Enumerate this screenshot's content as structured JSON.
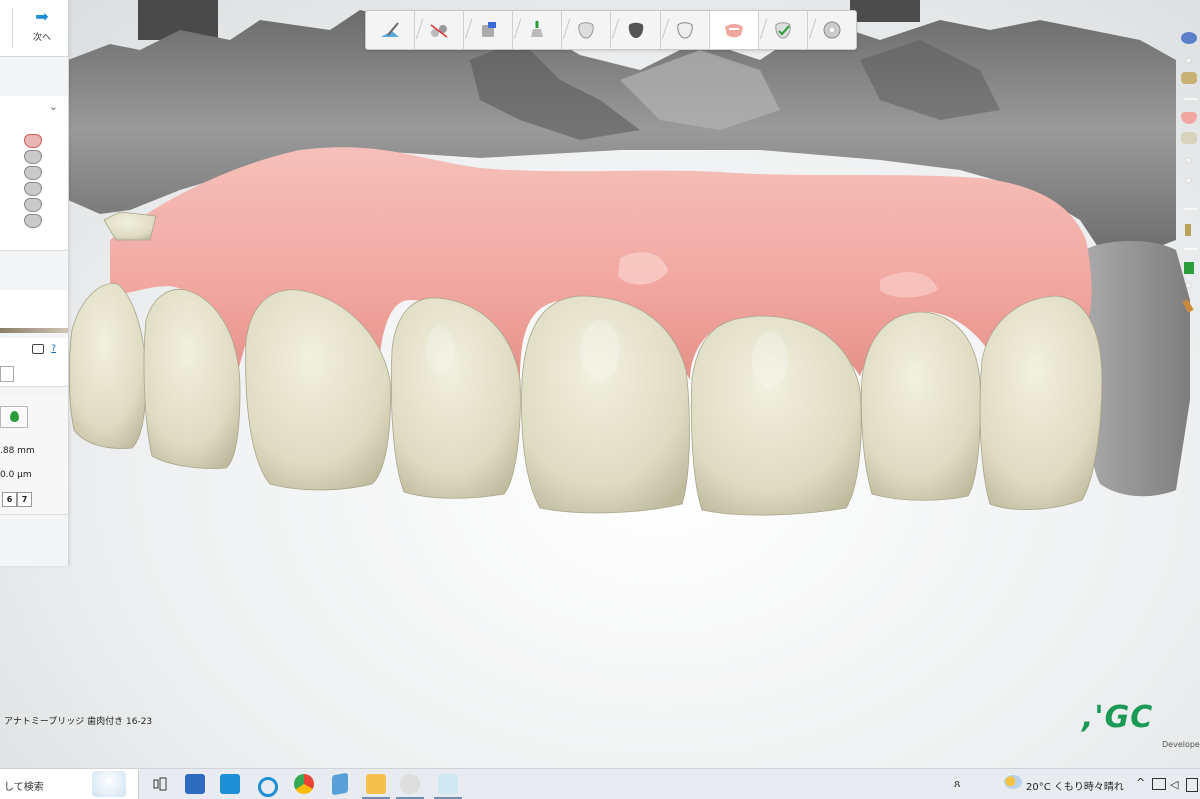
{
  "left_panel": {
    "next_label": "次へ",
    "help_link": "?",
    "thickness_value": ".88 mm",
    "offset_value": "0.0 μm",
    "number_boxes": [
      "6",
      "7"
    ]
  },
  "toolbar": {
    "steps": [
      {
        "icon": "scan-tool-icon"
      },
      {
        "icon": "trim-tool-icon"
      },
      {
        "icon": "die-tool-icon"
      },
      {
        "icon": "margin-tool-icon"
      },
      {
        "icon": "tooth-shape-icon"
      },
      {
        "icon": "tooth-dark-icon"
      },
      {
        "icon": "tooth-outline-icon"
      },
      {
        "icon": "gingiva-icon"
      },
      {
        "icon": "tooth-check-icon"
      },
      {
        "icon": "disc-export-icon"
      }
    ],
    "active_step": 7
  },
  "case_label": "アナトミーブリッジ 歯肉付き 16-23",
  "brand": {
    "logo_text": ",'GC",
    "subtitle": "Developed",
    "color": "#1a9a55"
  },
  "taskbar": {
    "search_text": "して検索",
    "weather": "20°C くもり時々晴れ",
    "apps": [
      "task-view-icon",
      "store-icon",
      "remote-icon",
      "cortana-icon",
      "chrome-icon",
      "explorer-icon",
      "folder-icon",
      "dental-app-icon",
      "dental-app-2-icon"
    ]
  },
  "colors": {
    "gingiva": "#f0a9a2",
    "tooth": "#e2e0c8",
    "model": "#8c8c8c",
    "accent": "#1c8fd6"
  }
}
